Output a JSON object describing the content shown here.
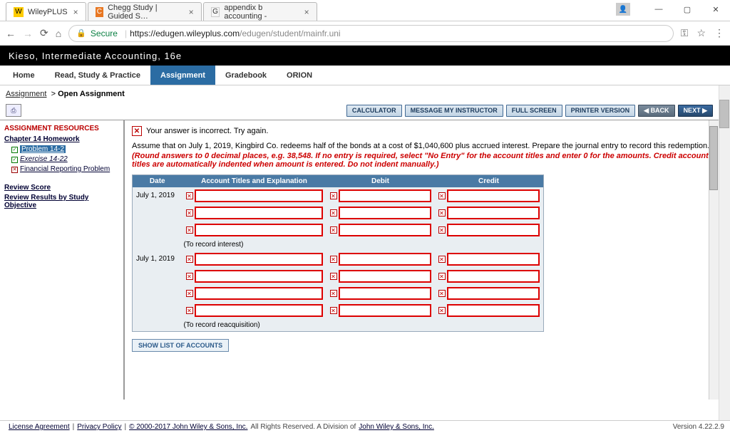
{
  "browser": {
    "tabs": [
      {
        "label": "WileyPLUS",
        "icon": "W",
        "iconBg": "#ffcc00"
      },
      {
        "label": "Chegg Study | Guided S…",
        "icon": "C",
        "iconBg": "#e87722"
      },
      {
        "label": "appendix b accounting -",
        "icon": "G",
        "iconBg": "#fff"
      }
    ],
    "secure": "Secure",
    "url_host": "https://edugen.wileyplus.com",
    "url_path": "/edugen/student/mainfr.uni"
  },
  "banner": {
    "subtitle": "Kieso, Intermediate Accounting, 16e"
  },
  "menu": [
    "Home",
    "Read, Study & Practice",
    "Assignment",
    "Gradebook",
    "ORION"
  ],
  "crumb": {
    "a": "Assignment",
    "b": "Open Assignment"
  },
  "toolbar": {
    "calc": "CALCULATOR",
    "msg": "MESSAGE MY INSTRUCTOR",
    "full": "FULL SCREEN",
    "print": "PRINTER VERSION",
    "back": "◀ BACK",
    "next": "NEXT ▶"
  },
  "sidebar": {
    "hdr": "ASSIGNMENT RESOURCES",
    "chapter": "Chapter 14 Homework",
    "items": [
      {
        "label": "Problem 14-2",
        "sel": true,
        "chk": "grn"
      },
      {
        "label": "Exercise 14-22",
        "sel": false,
        "chk": "grn"
      },
      {
        "label": "Financial Reporting Problem",
        "sel": false,
        "chk": "red"
      }
    ],
    "review1": "Review Score",
    "review2": "Review Results by Study Objective"
  },
  "work": {
    "err": "Your answer is incorrect.  Try again.",
    "prompt": "Assume that on July 1, 2019, Kingbird Co. redeems half of the bonds at a cost of $1,040,600 plus accrued interest. Prepare the journal entry to record this redemption.",
    "prompt_red": "(Round answers to 0 decimal places, e.g. 38,548. If no entry is required, select \"No Entry\" for the account titles and enter 0 for the amounts. Credit account titles are automatically indented when amount is entered. Do not indent manually.)",
    "headers": {
      "date": "Date",
      "acct": "Account Titles and Explanation",
      "debit": "Debit",
      "credit": "Credit"
    },
    "date1": "July 1, 2019",
    "cap1": "(To record interest)",
    "date2": "July 1, 2019",
    "cap2": "(To record reacquisition)",
    "show": "SHOW LIST OF ACCOUNTS"
  },
  "footer": {
    "license": "License Agreement",
    "privacy": "Privacy Policy",
    "copy": "© 2000-2017 John Wiley & Sons, Inc.",
    "rest": " All Rights Reserved. A Division of ",
    "co": "John Wiley & Sons, Inc.",
    "version": "Version 4.22.2.9"
  }
}
